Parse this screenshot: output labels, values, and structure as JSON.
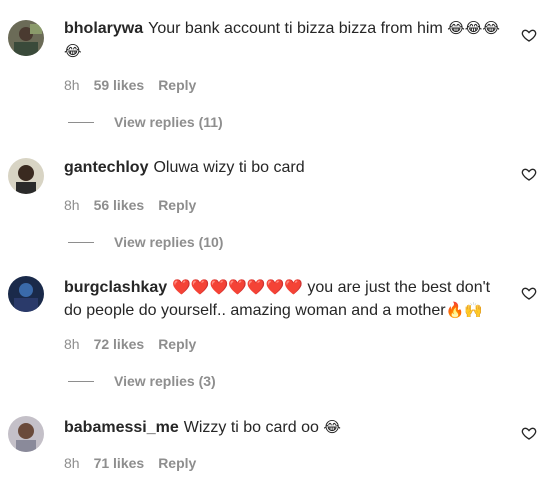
{
  "comments": [
    {
      "username": "bholarywa",
      "text": "Your bank account ti bizza bizza from him",
      "emoji_tail": "😂😂😂😂",
      "time": "8h",
      "likes": "59 likes",
      "reply": "Reply",
      "view_replies": "View replies (11)"
    },
    {
      "username": "gantechloy",
      "text": "Oluwa wizy ti bo card",
      "time": "8h",
      "likes": "56 likes",
      "reply": "Reply",
      "view_replies": "View replies (10)"
    },
    {
      "username": "burgclashkay",
      "hearts": "❤️❤️❤️❤️❤️❤️❤️",
      "text": "you are just the best don't do people do yourself.. amazing woman and a mother",
      "emoji_tail": "🔥🙌",
      "time": "8h",
      "likes": "72 likes",
      "reply": "Reply",
      "view_replies": "View replies (3)"
    },
    {
      "username": "babamessi_me",
      "text": "Wizzy ti bo card oo",
      "emoji_tail": "😂",
      "time": "8h",
      "likes": "71 likes",
      "reply": "Reply"
    }
  ],
  "icons": {
    "like": "heart-outline-icon"
  },
  "colors": {
    "meta_gray": "#8e8e8e",
    "text": "#262626",
    "heart_red": "#e0245e"
  }
}
